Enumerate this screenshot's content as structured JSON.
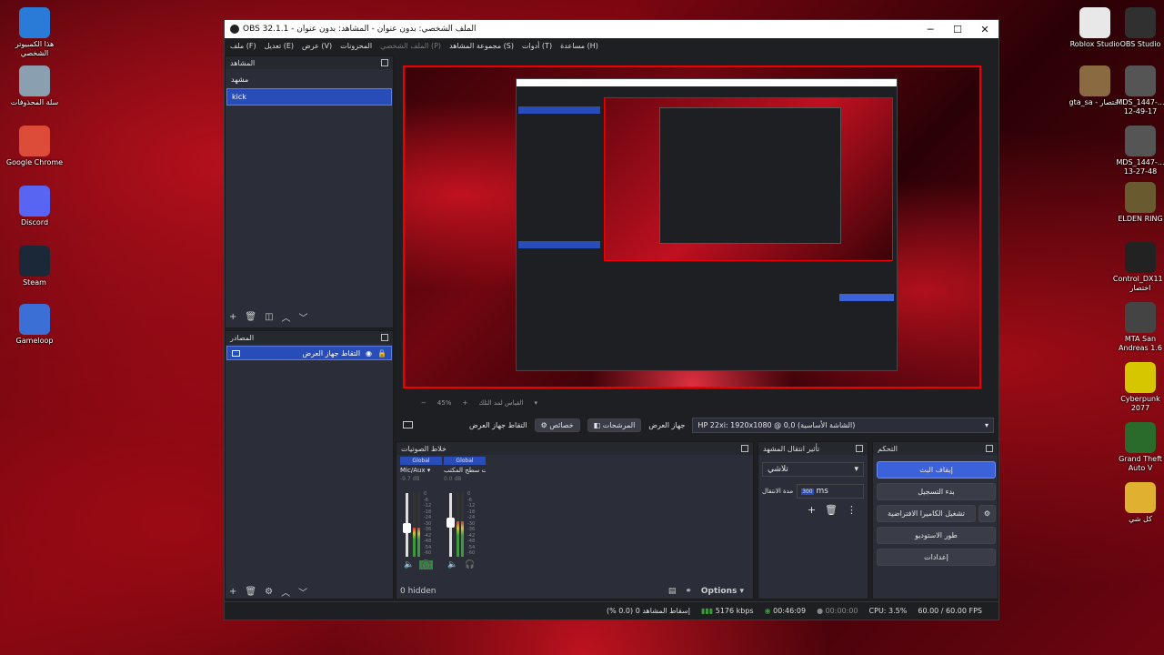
{
  "desktop_left": [
    {
      "label": "هذا الكمبيوتر الشخصي",
      "icon": "computer-icon",
      "color": "#2a7ad8"
    },
    {
      "label": "سلة المحذوفات",
      "icon": "recycle-bin-icon",
      "color": "#8aa0b0"
    },
    {
      "label": "Google Chrome",
      "icon": "chrome-icon",
      "color": "#dd4b39"
    },
    {
      "label": "Discord",
      "icon": "discord-icon",
      "color": "#5865f2"
    },
    {
      "label": "Steam",
      "icon": "steam-icon",
      "color": "#1b2838"
    },
    {
      "label": "Gameloop",
      "icon": "gameloop-icon",
      "color": "#3b6fd6"
    }
  ],
  "desktop_right": [
    {
      "label": "Roblox Studio",
      "icon": "roblox-studio-icon",
      "color": "#e8e8e8"
    },
    {
      "label": "OBS Studio",
      "icon": "obs-icon",
      "color": "#303030"
    },
    {
      "label": "gta_sa - اختصار",
      "icon": "gta-sa-icon",
      "color": "#8a6a40"
    },
    {
      "label": "MDS_1447-... 12-49-17",
      "icon": "file-icon",
      "color": "#555"
    },
    {
      "label": "MDS_1447-... 13-27-48",
      "icon": "file-icon",
      "color": "#555"
    },
    {
      "label": "ELDEN RING",
      "icon": "elden-ring-icon",
      "color": "#6a5a30"
    },
    {
      "label": "Control_DX11 - اختصار",
      "icon": "control-icon",
      "color": "#222"
    },
    {
      "label": "MTA San Andreas 1.6",
      "icon": "mta-icon",
      "color": "#444"
    },
    {
      "label": "Cyberpunk 2077",
      "icon": "cyberpunk-icon",
      "color": "#d6c600"
    },
    {
      "label": "Grand Theft Auto V",
      "icon": "gtav-icon",
      "color": "#2a6a2a"
    },
    {
      "label": "كل شي",
      "icon": "folder-icon",
      "color": "#e0b030"
    }
  ],
  "window": {
    "title": "OBS 32.1.1 - الملف الشخصي: بدون عنوان - المشاهد: بدون عنوان",
    "minimize": "─",
    "maximize": "☐",
    "close": "✕"
  },
  "menu": [
    {
      "label": "ملف (F)",
      "dim": false
    },
    {
      "label": "تعديل (E)",
      "dim": false
    },
    {
      "label": "عرض (V)",
      "dim": false
    },
    {
      "label": "المحزونات",
      "dim": false
    },
    {
      "label": "الملف الشخصي (P)",
      "dim": true
    },
    {
      "label": "مجموعة المشاهد (S)",
      "dim": false
    },
    {
      "label": "أدوات (T)",
      "dim": false
    },
    {
      "label": "مساعدة (H)",
      "dim": false
    }
  ],
  "scenes": {
    "title": "المشاهد",
    "items": [
      {
        "label": "مشهد",
        "selected": false
      },
      {
        "label": "kick",
        "selected": true
      }
    ]
  },
  "sources": {
    "title": "المصادر",
    "items": [
      {
        "label": "التقاط جهاز العرض",
        "selected": true
      }
    ]
  },
  "preview_bar": {
    "zoom": "45%",
    "label": "القياس لمد التلك"
  },
  "source_props_bar": {
    "source_name": "التقاط جهاز العرض",
    "properties": "خصائص",
    "filters": "المرشحات",
    "display_label": "جهاز العرض",
    "display_value": "HP 22xi: 1920x1080 @ 0,0 (الشاشة الأساسية)"
  },
  "mixer": {
    "title": "خلاط الصوتيات",
    "channels": [
      {
        "badge": "Global",
        "name": "Mic/Aux",
        "db": "-9.7 dB",
        "level": 0.45
      },
      {
        "badge": "Global",
        "name": "صوت سطح المكتب",
        "db": "0.0 dB",
        "level": 0.55
      }
    ],
    "scale": [
      "0",
      "-6",
      "-12",
      "-18",
      "-24",
      "-30",
      "-36",
      "-42",
      "-48",
      "-54",
      "-60"
    ],
    "hidden": "0 hidden",
    "options": "Options"
  },
  "transitions": {
    "title": "تأثير انتقال المشهد",
    "selected": "تلاشي",
    "duration_label": "مدة الانتقال",
    "duration_value": "ms",
    "duration_prefix": "300"
  },
  "controls": {
    "title": "التحكم",
    "stop_stream": "إيقاف البث",
    "start_recording": "بدء التسجيل",
    "virtual_camera": "تشغيل الكاميرا الافتراضية",
    "studio_mode": "طور الاستوديو",
    "settings": "إعدادات"
  },
  "status": {
    "dropped": "إسقاط المشاهد 0 (0.0 %)",
    "bitrate": "5176 kbps",
    "stream_time": "00:46:09",
    "record_time": "00:00:00",
    "cpu": "CPU: 3.5%",
    "fps": "60.00 / 60.00 FPS"
  },
  "colors": {
    "accent": "#284cb8",
    "stop_button": "#3b62d8",
    "preview_border": "#e00000"
  }
}
